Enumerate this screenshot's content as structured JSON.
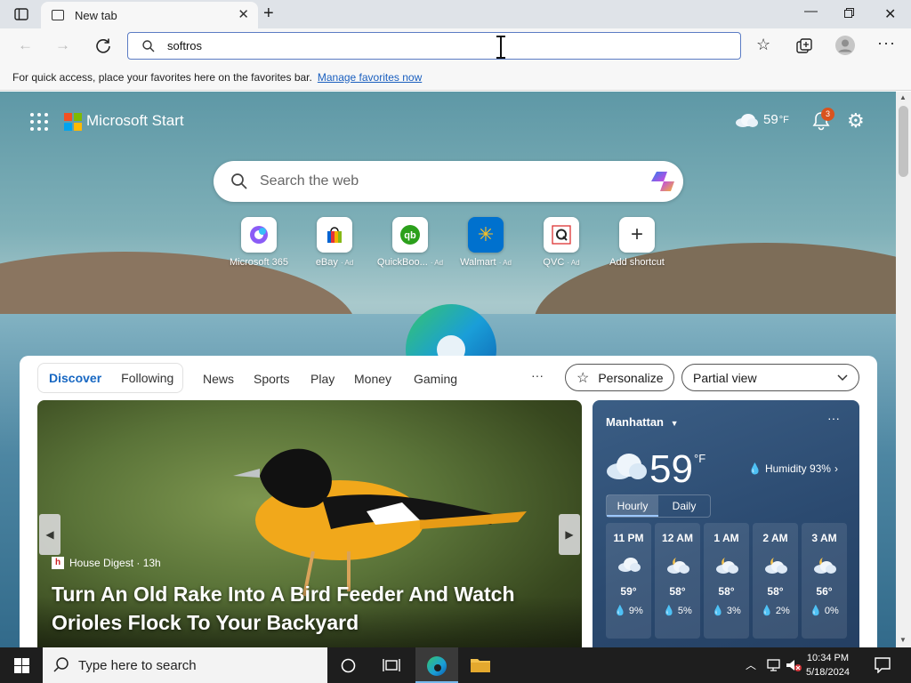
{
  "browser": {
    "tab_title": "New tab",
    "address_value": "softros",
    "favbar_text": "For quick access, place your favorites here on the favorites bar.",
    "favbar_link": "Manage favorites now"
  },
  "start": {
    "brand": "Microsoft Start",
    "weather_temp": "59",
    "weather_unit": "°F",
    "notification_count": "3",
    "search_placeholder": "Search the web",
    "shortcuts": [
      {
        "label": "Microsoft 365",
        "ad": ""
      },
      {
        "label": "eBay",
        "ad": "· Ad"
      },
      {
        "label": "QuickBoo...",
        "ad": "· Ad"
      },
      {
        "label": "Walmart",
        "ad": "· Ad"
      },
      {
        "label": "QVC",
        "ad": "· Ad"
      },
      {
        "label": "Add shortcut",
        "ad": ""
      }
    ]
  },
  "feed": {
    "tabs": [
      "Discover",
      "Following"
    ],
    "nav": [
      "News",
      "Sports",
      "Play",
      "Money",
      "Gaming"
    ],
    "more": "···",
    "personalize": "Personalize",
    "view_select": "Partial view",
    "article": {
      "source": "House Digest · 13h",
      "title": "Turn An Old Rake Into A Bird Feeder And Watch Orioles Flock To Your Backyard"
    }
  },
  "weather": {
    "location": "Manhattan",
    "temp": "59",
    "unit": "°F",
    "humidity": "Humidity 93%",
    "tab_hourly": "Hourly",
    "tab_daily": "Daily",
    "hours": [
      {
        "time": "11 PM",
        "temp": "59°",
        "precip": "9%",
        "icon": "cloudy"
      },
      {
        "time": "12 AM",
        "temp": "58°",
        "precip": "5%",
        "icon": "partly-cloudy-night"
      },
      {
        "time": "1 AM",
        "temp": "58°",
        "precip": "3%",
        "icon": "partly-cloudy-night"
      },
      {
        "time": "2 AM",
        "temp": "58°",
        "precip": "2%",
        "icon": "partly-cloudy-night"
      },
      {
        "time": "3 AM",
        "temp": "56°",
        "precip": "0%",
        "icon": "partly-cloudy-night"
      }
    ]
  },
  "taskbar": {
    "search_placeholder": "Type here to search",
    "time": "10:34 PM",
    "date": "5/18/2024"
  },
  "colors": {
    "accent": "#1a5fbf",
    "edge_blue": "#0c7bd6"
  }
}
